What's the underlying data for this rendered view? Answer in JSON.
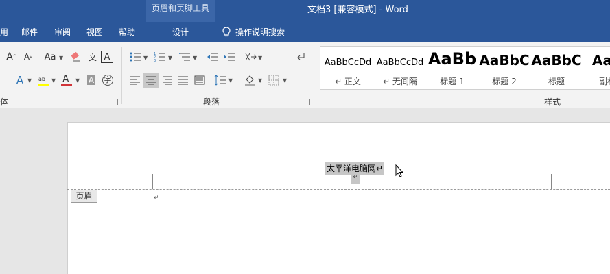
{
  "title_bar": {
    "context_tool_title": "页眉和页脚工具",
    "document_title": "文档3 [兼容模式]  -  Word"
  },
  "tabs": [
    {
      "label": "用"
    },
    {
      "label": "邮件"
    },
    {
      "label": "审阅"
    },
    {
      "label": "视图"
    },
    {
      "label": "帮助"
    }
  ],
  "context_tab": {
    "label": "设计"
  },
  "tell_me": {
    "label": "操作说明搜索",
    "icon": "lightbulb-icon"
  },
  "ribbon": {
    "groups": [
      {
        "label": "体"
      },
      {
        "label": "段落"
      },
      {
        "label": "样式"
      }
    ],
    "font": {
      "case_label": "Aa",
      "grow_label": "A",
      "shrink_label": "A",
      "char_border_label": "A",
      "phonetic_label": "文",
      "enclose_label": "字",
      "font_color": "#d13438",
      "highlight_color": "#ffff00"
    },
    "styles": [
      {
        "sample": "AaBbCcDd",
        "name": "↵ 正文"
      },
      {
        "sample": "AaBbCcDd",
        "name": "↵ 无间隔"
      },
      {
        "sample": "AaBb",
        "name": "标题 1"
      },
      {
        "sample": "AaBbC",
        "name": "标题 2"
      },
      {
        "sample": "AaBbC",
        "name": "标题"
      },
      {
        "sample": "AaB",
        "name": "副标"
      }
    ]
  },
  "document": {
    "header_text": "太平洋电脑网↵",
    "paragraph_mark": "↵",
    "header_tag": "页眉"
  },
  "colors": {
    "brand": "#2b579a",
    "context_tab": "#3b66a8"
  }
}
